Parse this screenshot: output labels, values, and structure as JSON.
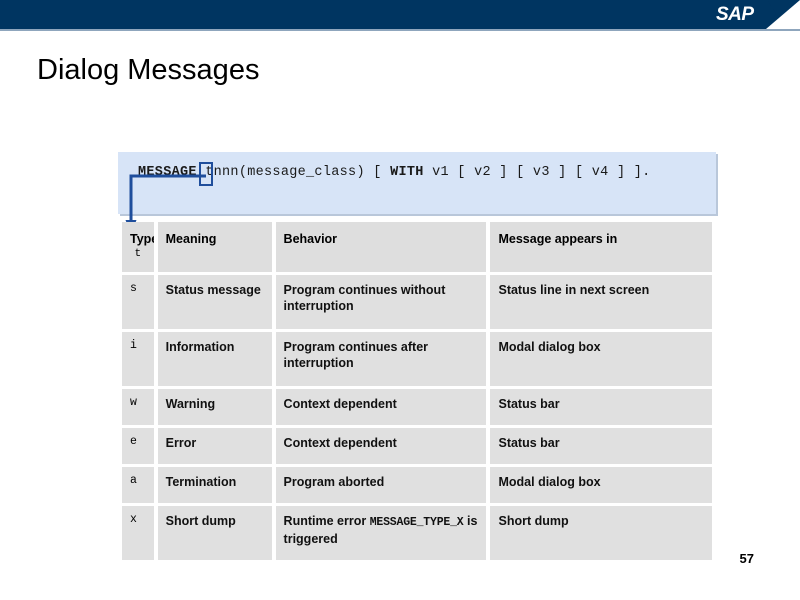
{
  "banner": {
    "logo_text": "SAP",
    "logo_name": "sap-logo",
    "background_color": "#003561",
    "underline_color": "#8fa6bd"
  },
  "slide": {
    "title": "Dialog Messages",
    "page_number": "57"
  },
  "code_box": {
    "background_color": "#d7e4f7",
    "highlight_color": "#1f4e9c",
    "segments": {
      "keyword_message": "MESSAGE",
      "param": "tnnn(message_class)",
      "bracket_open": "[",
      "keyword_with": "WITH",
      "v1": "v1",
      "v2": "[ v2 ]",
      "v3": "[ v3 ]",
      "v4": "[ v4 ]",
      "bracket_close": "]."
    },
    "full_text": "MESSAGE tnnn(message_class) [ WITH v1 [ v2 ] [ v3 ] [ v4 ] ].",
    "highlighted_token": "t"
  },
  "table": {
    "headers": {
      "type_main": "Type",
      "type_sub": "t",
      "meaning": "Meaning",
      "behavior": "Behavior",
      "appears_in": "Message appears in"
    },
    "rows": [
      {
        "type": "s",
        "meaning": "Status message",
        "behavior": "Program continues without interruption",
        "behavior_mono": "",
        "behavior_tail": "",
        "appears_in": "Status line in next screen"
      },
      {
        "type": "i",
        "meaning": "Information",
        "behavior": "Program continues after interruption",
        "behavior_mono": "",
        "behavior_tail": "",
        "appears_in": "Modal dialog box"
      },
      {
        "type": "w",
        "meaning": "Warning",
        "behavior": "Context dependent",
        "behavior_mono": "",
        "behavior_tail": "",
        "appears_in": "Status bar"
      },
      {
        "type": "e",
        "meaning": "Error",
        "behavior": "Context dependent",
        "behavior_mono": "",
        "behavior_tail": "",
        "appears_in": "Status bar"
      },
      {
        "type": "a",
        "meaning": "Termination",
        "behavior": "Program aborted",
        "behavior_mono": "",
        "behavior_tail": "",
        "appears_in": "Modal dialog box"
      },
      {
        "type": "x",
        "meaning": "Short dump",
        "behavior": "Runtime error ",
        "behavior_mono": "MESSAGE_TYPE_X",
        "behavior_tail": " is triggered",
        "appears_in": "Short dump"
      }
    ]
  }
}
